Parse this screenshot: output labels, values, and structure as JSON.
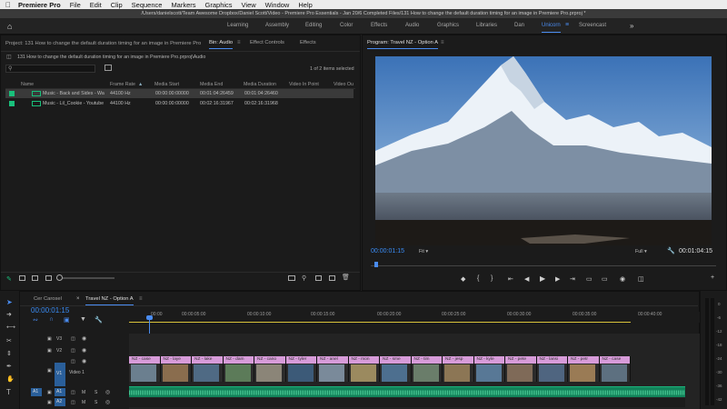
{
  "menubar": {
    "app": "Premiere Pro",
    "items": [
      "File",
      "Edit",
      "Clip",
      "Sequence",
      "Markers",
      "Graphics",
      "View",
      "Window",
      "Help"
    ]
  },
  "titlebar": {
    "path": "/Users/danielscott/Team Awesome Dropbox/Daniel Scott/Video - Premiere Pro Essentials - Jan 20/6 Completed Files/131 How to change the default duration timing for an image in Premiere Pro.prproj *"
  },
  "workspaces": {
    "items": [
      "Learning",
      "Assembly",
      "Editing",
      "Color",
      "Effects",
      "Audio",
      "Graphics",
      "Libraries",
      "Dan",
      "Unicorn",
      "Screencast"
    ],
    "active": "Unicorn"
  },
  "project": {
    "title": "Project: 131 How to change the default duration timing for an image in Premiere Pro",
    "tabs": [
      "Bin: Audio",
      "Effect Controls",
      "Effects"
    ],
    "path": "131 How to change the default duration timing for an image in Premiere Pro.prproj\\Audio",
    "selection_status": "1 of 2 items selected",
    "columns": [
      "Name",
      "Frame Rate",
      "Media Start",
      "Media End",
      "Media Duration",
      "Video In Point",
      "Video Ou"
    ],
    "rows": [
      {
        "name": "Music - Back and Sides - Wa",
        "frame_rate": "44100 Hz",
        "media_start": "00:00:00:00000",
        "media_end": "00:01:04:26459",
        "media_duration": "00:01:04:26460"
      },
      {
        "name": "Music - Lil_Cookie - Youtube",
        "frame_rate": "44100 Hz",
        "media_start": "00:00:00:00000",
        "media_end": "00:02:16:31967",
        "media_duration": "00:02:16:31968"
      }
    ]
  },
  "program": {
    "title": "Program: Travel NZ - Option A",
    "current_tc": "00:00:01:15",
    "fit": "Fit",
    "quality": "Full",
    "duration_tc": "00:01:04:15"
  },
  "timeline": {
    "tabs": [
      "Cer Carosel",
      "Travel NZ - Option A"
    ],
    "active_tab": "Travel NZ - Option A",
    "timecode": "00:00:01:15",
    "ruler": [
      "00:00",
      "00:00:05:00",
      "00:00:10:00",
      "00:00:15:00",
      "00:00:20:00",
      "00:00:25:00",
      "00:00:30:00",
      "00:00:35:00",
      "00:00:40:00"
    ],
    "tracks": {
      "v3": "V3",
      "v2": "V2",
      "v1": "V1",
      "video1": "Video 1",
      "a1": "A1",
      "a2": "A2",
      "a_src": "A1",
      "a_src2": "A1",
      "m": "M",
      "s": "S"
    },
    "clips": [
      "NZ - case",
      "NZ - laye",
      "NZ - lake",
      "NZ - dam",
      "NZ - cano",
      "NZ - tyler",
      "NZ - anel",
      "NZ - mon",
      "NZ - sme",
      "NZ - tim",
      "NZ - jesp",
      "NZ - kyle",
      "NZ - pete",
      "NZ - lansi",
      "NZ - petr",
      "NZ - case"
    ]
  },
  "meters": {
    "scale": [
      "0",
      "-6",
      "-12",
      "-18",
      "-24",
      "-30",
      "-36",
      "-42"
    ]
  },
  "colors": {
    "accent": "#4a8cf0",
    "audio_clip": "#19c07b",
    "video_clip_header": "#d79bd9",
    "timecode": "#3a8cf5"
  }
}
